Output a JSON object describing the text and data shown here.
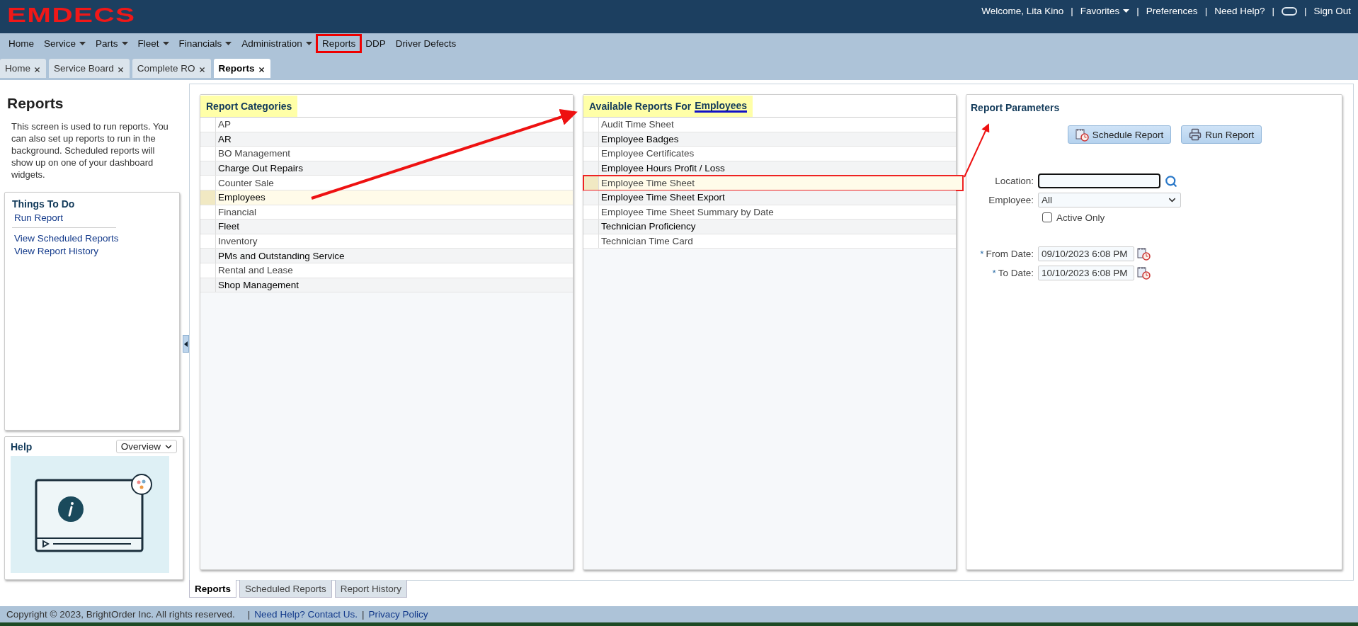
{
  "header": {
    "logo": "EMDECS",
    "welcome": "Welcome, Lita Kino",
    "separator": "|",
    "links": [
      {
        "kind": "dropdown",
        "label": "Favorites"
      },
      {
        "kind": "link",
        "label": "Preferences"
      },
      {
        "kind": "link",
        "label": "Need Help?"
      },
      {
        "kind": "icon"
      },
      {
        "kind": "link",
        "label": "Sign Out"
      }
    ]
  },
  "menu": [
    {
      "label": "Home",
      "dropdown": false,
      "annotated": false
    },
    {
      "label": "Service",
      "dropdown": true,
      "annotated": false
    },
    {
      "label": "Parts",
      "dropdown": true,
      "annotated": false
    },
    {
      "label": "Fleet",
      "dropdown": true,
      "annotated": false
    },
    {
      "label": "Financials",
      "dropdown": true,
      "annotated": false
    },
    {
      "label": "Administration",
      "dropdown": true,
      "annotated": false
    },
    {
      "label": "Reports",
      "dropdown": false,
      "annotated": true
    },
    {
      "label": "DDP",
      "dropdown": false,
      "annotated": false
    },
    {
      "label": "Driver Defects",
      "dropdown": false,
      "annotated": false
    }
  ],
  "tabs": [
    {
      "label": "Home",
      "selected": false
    },
    {
      "label": "Service Board",
      "selected": false
    },
    {
      "label": "Complete RO",
      "selected": false
    },
    {
      "label": "Reports",
      "selected": true
    }
  ],
  "sidebar": {
    "title": "Reports",
    "description": "This screen is used to run reports. You can also set up reports to run in the background. Scheduled reports will show up on one of your dashboard widgets.",
    "todo": {
      "title": "Things To Do",
      "groups": [
        [
          "Run Report"
        ],
        [
          "View Scheduled Reports",
          "View Report History"
        ]
      ]
    },
    "help": {
      "title": "Help",
      "select": "Overview"
    }
  },
  "categories": {
    "title": "Report Categories",
    "items": [
      {
        "label": "AP",
        "selected": false
      },
      {
        "label": "AR",
        "selected": false
      },
      {
        "label": "BO Management",
        "selected": false
      },
      {
        "label": "Charge Out Repairs",
        "selected": false
      },
      {
        "label": "Counter Sale",
        "selected": false
      },
      {
        "label": "Employees",
        "selected": true
      },
      {
        "label": "Financial",
        "selected": false
      },
      {
        "label": "Fleet",
        "selected": false
      },
      {
        "label": "Inventory",
        "selected": false
      },
      {
        "label": "PMs and Outstanding Service",
        "selected": false
      },
      {
        "label": "Rental and Lease",
        "selected": false
      },
      {
        "label": "Shop Management",
        "selected": false
      }
    ]
  },
  "available": {
    "title_prefix": "Available Reports For",
    "title_link": "Employees",
    "items": [
      {
        "label": "Audit Time Sheet",
        "selected": false,
        "annotated": false
      },
      {
        "label": "Employee Badges",
        "selected": false,
        "annotated": false
      },
      {
        "label": "Employee Certificates",
        "selected": false,
        "annotated": false
      },
      {
        "label": "Employee Hours Profit / Loss",
        "selected": false,
        "annotated": false
      },
      {
        "label": "Employee Time Sheet",
        "selected": true,
        "annotated": true
      },
      {
        "label": "Employee Time Sheet Export",
        "selected": false,
        "annotated": false
      },
      {
        "label": "Employee Time Sheet Summary by Date",
        "selected": false,
        "annotated": false
      },
      {
        "label": "Technician Proficiency",
        "selected": false,
        "annotated": false
      },
      {
        "label": "Technician Time Card",
        "selected": false,
        "annotated": false
      }
    ]
  },
  "parameters": {
    "title": "Report Parameters",
    "buttons": [
      {
        "kind": "schedule",
        "label": "Schedule Report"
      },
      {
        "kind": "run",
        "label": "Run Report"
      }
    ],
    "fields": [
      {
        "kind": "lookup",
        "label": "Location:"
      },
      {
        "kind": "select",
        "label": "Employee:",
        "value": "All"
      },
      {
        "kind": "checkbox",
        "label": "Active Only",
        "checked": false
      },
      {
        "kind": "date",
        "label": "From Date:",
        "marker": "*",
        "value": "09/10/2023 6:08 PM"
      },
      {
        "kind": "date",
        "label": "To Date:",
        "marker": "*",
        "value": "10/10/2023 6:08 PM"
      }
    ]
  },
  "bottom_tabs": [
    {
      "label": "Reports",
      "selected": true
    },
    {
      "label": "Scheduled Reports",
      "selected": false
    },
    {
      "label": "Report History",
      "selected": false
    }
  ],
  "footer": {
    "separator": "|",
    "copyright": "Copyright © 2023, BrightOrder Inc. All rights reserved.",
    "links": [
      "Need Help? Contact Us.",
      "Privacy Policy"
    ]
  }
}
